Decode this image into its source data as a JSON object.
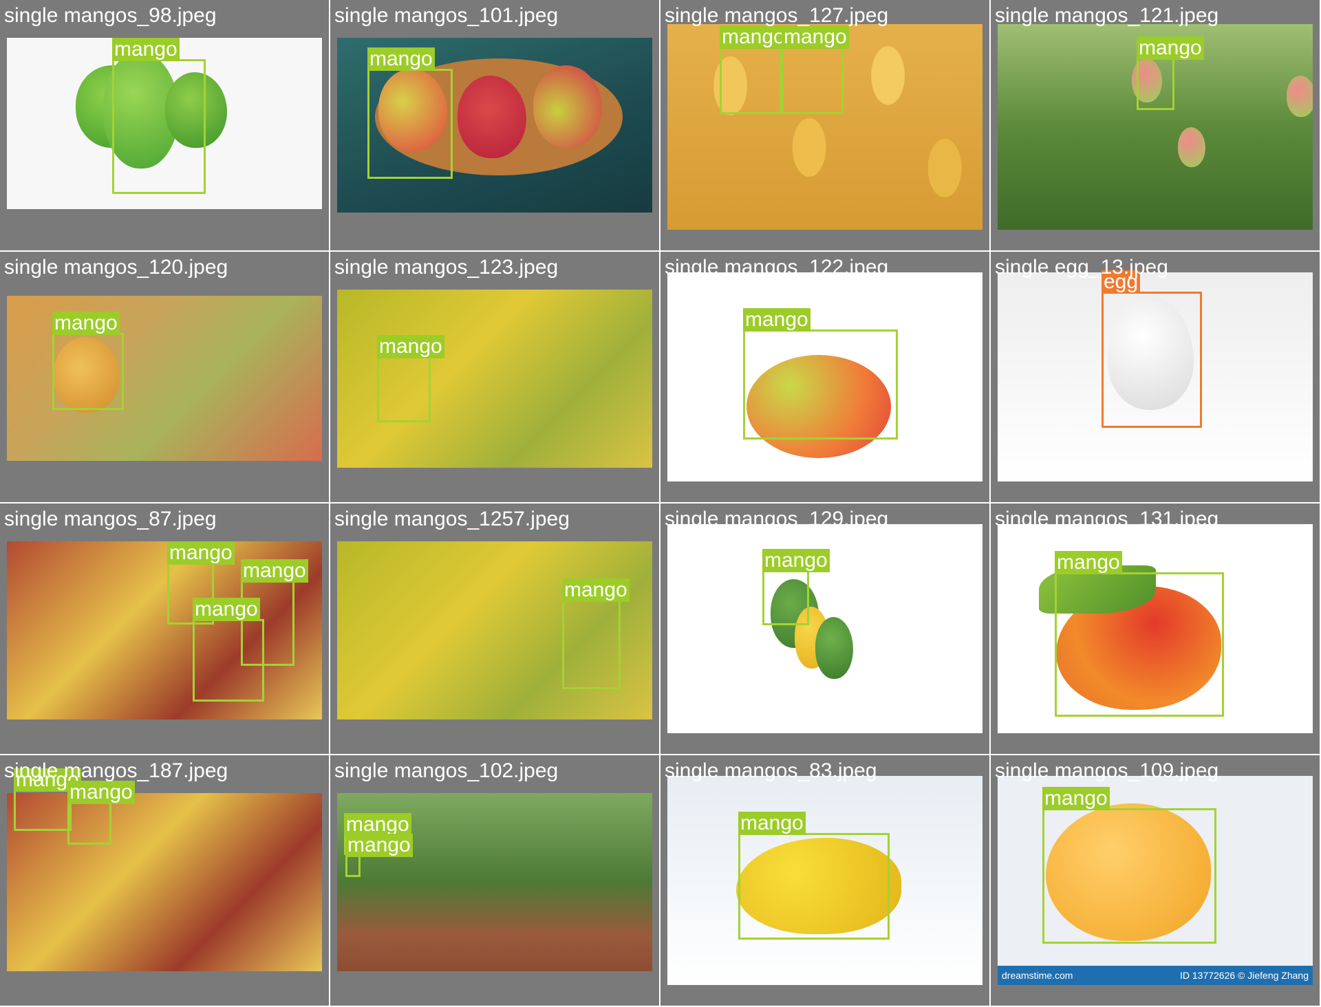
{
  "tiles": [
    {
      "title": "single mangos_98.jpeg",
      "boxes": [
        {
          "label": "mango"
        }
      ]
    },
    {
      "title": "single mangos_101.jpeg",
      "boxes": [
        {
          "label": "mango"
        }
      ]
    },
    {
      "title": "single mangos_127.jpeg",
      "boxes": [
        {
          "label": "mango"
        },
        {
          "label": "mango"
        }
      ]
    },
    {
      "title": "single mangos_121.jpeg",
      "boxes": [
        {
          "label": "mango"
        }
      ]
    },
    {
      "title": "single mangos_120.jpeg",
      "boxes": [
        {
          "label": "mango"
        }
      ]
    },
    {
      "title": "single mangos_123.jpeg",
      "boxes": [
        {
          "label": "mango"
        }
      ]
    },
    {
      "title": "single mangos_122.jpeg",
      "boxes": [
        {
          "label": "mango"
        }
      ]
    },
    {
      "title": "single egg_13.jpeg",
      "boxes": [
        {
          "label": "egg"
        }
      ]
    },
    {
      "title": "single mangos_87.jpeg",
      "boxes": [
        {
          "label": "mango"
        },
        {
          "label": "mango"
        },
        {
          "label": "mango"
        }
      ]
    },
    {
      "title": "single mangos_1257.jpeg",
      "boxes": [
        {
          "label": "mango"
        }
      ]
    },
    {
      "title": "single mangos_129.jpeg",
      "boxes": [
        {
          "label": "mango"
        }
      ]
    },
    {
      "title": "single mangos_131.jpeg",
      "boxes": [
        {
          "label": "mango"
        }
      ]
    },
    {
      "title": "single mangos_187.jpeg",
      "boxes": [
        {
          "label": "mango"
        },
        {
          "label": "mango"
        }
      ]
    },
    {
      "title": "single mangos_102.jpeg",
      "boxes": [
        {
          "label": "mango"
        },
        {
          "label": "mango"
        }
      ]
    },
    {
      "title": "single mangos_83.jpeg",
      "boxes": [
        {
          "label": "mango"
        }
      ]
    },
    {
      "title": "single mangos_109.jpeg",
      "boxes": [
        {
          "label": "mango"
        }
      ]
    }
  ],
  "watermark": {
    "site": "dreamstime.com",
    "id": "ID 13772626 © Jiefeng Zhang"
  },
  "colors": {
    "tile_background": "#7a7a7a",
    "mango_box": "#a4d233",
    "egg_box": "#f07a2e"
  }
}
